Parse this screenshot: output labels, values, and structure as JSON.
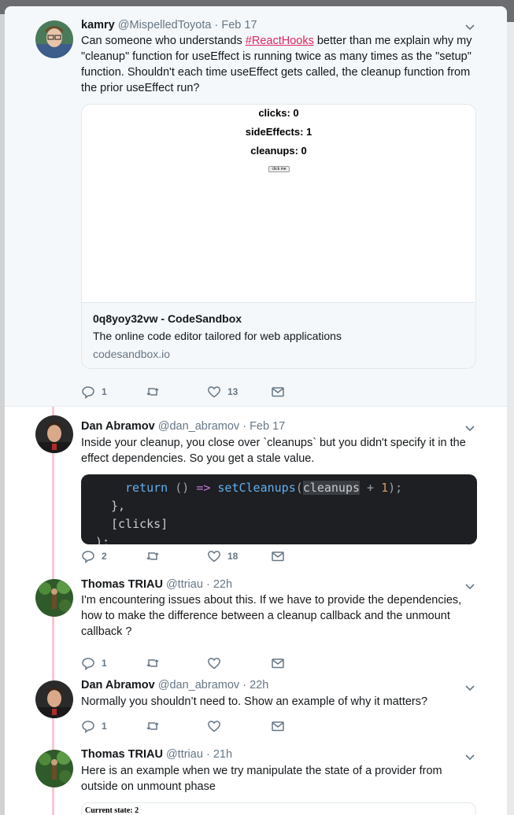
{
  "tweets": [
    {
      "name": "kamry",
      "handle": "@MispelledToyota",
      "time": "Feb 17",
      "text_before": "Can someone who understands ",
      "hashtag": "#ReactHooks",
      "text_after": " better than me explain why my \"cleanup\" function for useEffect is running twice as many times as the \"setup\" function. Shouldn't each time useEffect gets called, the cleanup function from the prior useEffect run?",
      "card": {
        "preview_lines": [
          "clicks: 0",
          "sideEffects: 1",
          "cleanups: 0"
        ],
        "button": "click me",
        "title": "0q8yoy32vw - CodeSandbox",
        "description": "The online code editor tailored for web applications",
        "domain": "codesandbox.io"
      },
      "replies": "1",
      "retweets": "",
      "likes": "13"
    },
    {
      "name": "Dan Abramov",
      "handle": "@dan_abramov",
      "time": "Feb 17",
      "text": "Inside your cleanup, you close over `cleanups` but you didn't specify it in the effect dependencies. So you get a stale value.",
      "code": {
        "ret": "return",
        "parens": "()",
        "arrow": "=>",
        "fn": "setCleanups",
        "open": "(",
        "var": "cleanups",
        "plus": " + ",
        "num": "1",
        "close": ");",
        "line2": "},",
        "line3": "[clicks]",
        "line4": ");"
      },
      "replies": "2",
      "retweets": "",
      "likes": "18"
    },
    {
      "name": "Thomas TRIAU",
      "handle": "@ttriau",
      "time": "22h",
      "text": "I'm encountering issues about this. If we have to provide the dependencies, how to make the difference between a cleanup callback and the unmount callback ?",
      "replies": "1",
      "retweets": "",
      "likes": ""
    },
    {
      "name": "Dan Abramov",
      "handle": "@dan_abramov",
      "time": "22h",
      "text": "Normally you shouldn’t need to. Show an example of why it matters?",
      "replies": "1",
      "retweets": "",
      "likes": ""
    },
    {
      "name": "Thomas TRIAU",
      "handle": "@ttriau",
      "time": "21h",
      "text": "Here is an example when we try manipulate the state of a provider from outside on unmount phase",
      "image_text": "Current state: 2"
    }
  ],
  "dot": "·",
  "colors": {
    "hashtag": "#e0245e",
    "thread_line": "#f7c8d4",
    "muted": "#657786"
  },
  "icons": [
    "chevron-down-icon",
    "reply-icon",
    "retweet-icon",
    "like-icon",
    "message-icon"
  ]
}
